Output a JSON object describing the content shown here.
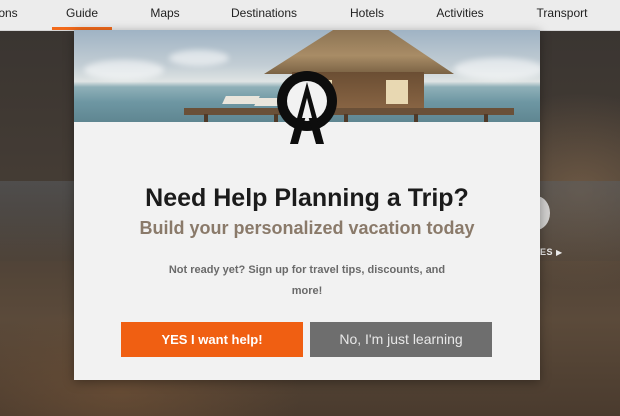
{
  "nav": {
    "items": [
      {
        "label": "ons"
      },
      {
        "label": "Guide",
        "active": true
      },
      {
        "label": "Maps"
      },
      {
        "label": "Destinations"
      },
      {
        "label": "Hotels"
      },
      {
        "label": "Activities"
      },
      {
        "label": "Transport"
      }
    ]
  },
  "background": {
    "more_link": "ES",
    "more_icon": "play-arrow-icon"
  },
  "modal": {
    "logo_icon": "compass-a-logo-icon",
    "title": "Need Help Planning a Trip?",
    "subtitle": "Build your personalized vacation today",
    "body": "Not ready yet? Sign up for travel tips, discounts, and more!",
    "yes_button": "YES I want help!",
    "no_button": "No, I'm just learning"
  },
  "colors": {
    "accent": "#f05f12",
    "secondary_button": "#6e6e6e",
    "nav_active_underline": "#f26a1b"
  }
}
